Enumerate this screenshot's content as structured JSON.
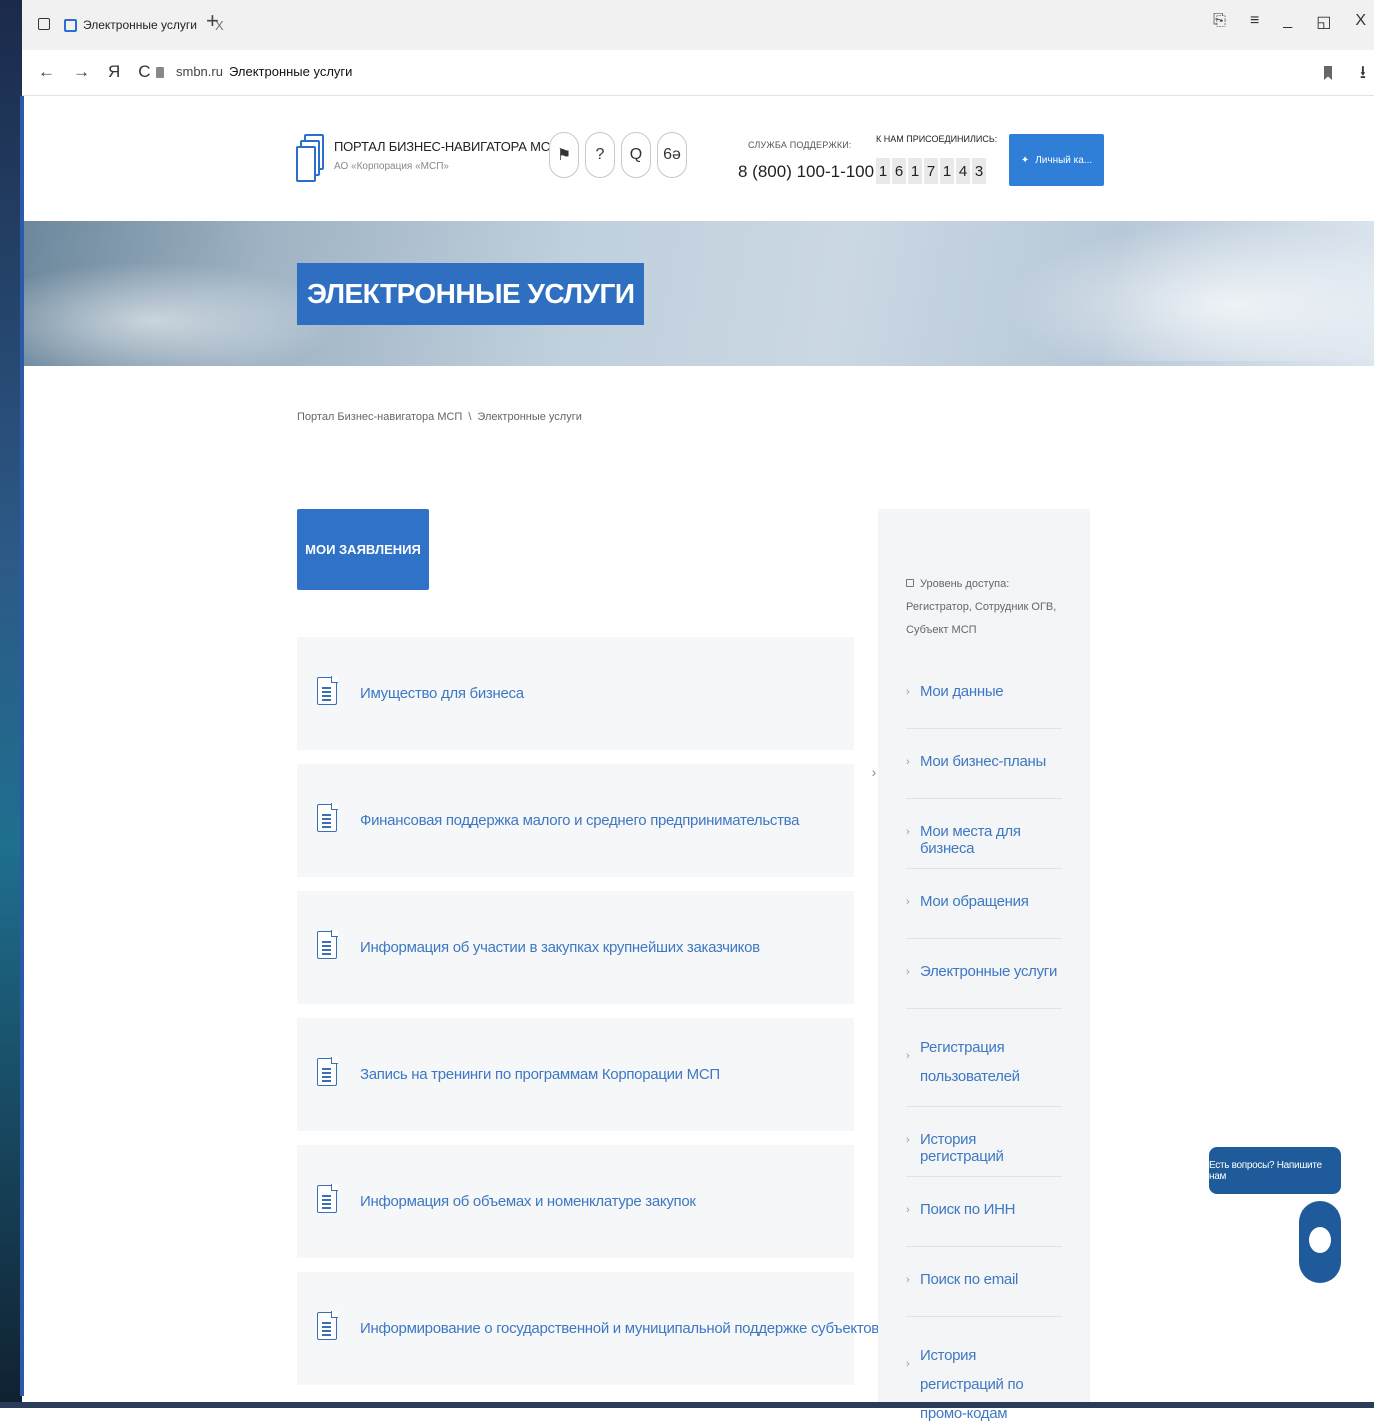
{
  "browser": {
    "tab_title": "Электронные услуги",
    "tab_close": "X",
    "new_tab": "+",
    "url_domain": "smbn.ru",
    "url_title": "Электронные услуги",
    "nav": {
      "back": "←",
      "forward": "→",
      "home": "Я",
      "reload": "C"
    },
    "window_controls": [
      "⎘",
      "≡",
      "_",
      "◱",
      "X"
    ],
    "download": "⭳"
  },
  "header": {
    "logo_title": "ПОРТАЛ БИЗНЕС-НАВИГАТОРА МСП",
    "logo_subtitle": "АО «Корпорация «МСП»",
    "icons": [
      {
        "name": "language-flag-icon",
        "glyph": "⚑"
      },
      {
        "name": "help-icon",
        "glyph": "?"
      },
      {
        "name": "search-icon",
        "glyph": "Q"
      },
      {
        "name": "accessibility-glasses-icon",
        "glyph": "6ə"
      }
    ],
    "support_label": "СЛУЖБА ПОДДЕРЖКИ:",
    "support_phone": "8 (800) 100-1-100",
    "joined_label": "К НАМ ПРИСОЕДИНИЛИСЬ:",
    "joined_digits": [
      "1",
      "6",
      "1",
      "7",
      "1",
      "4",
      "3"
    ],
    "account_button": "Личный ка..."
  },
  "hero": {
    "title": "ЭЛЕКТРОННЫЕ УСЛУГИ"
  },
  "breadcrumb": {
    "home": "Портал Бизнес-навигатора МСП",
    "separator": "\\",
    "current": "Электронные услуги"
  },
  "my_applications_button": "МОИ ЗАЯВЛЕНИЯ",
  "services": [
    "Имущество для бизнеса",
    "Финансовая поддержка малого и среднего предпринимательства",
    "Информация об участии в закупках крупнейших заказчиков",
    "Запись на тренинги по программам Корпорации МСП",
    "Информация об объемах и номенклатуре закупок",
    "Информирование о государственной и муниципальной поддержке субъектов МСП"
  ],
  "sidebar": {
    "access_level": "Уровень доступа: Регистратор, Сотрудник ОГВ, Субъект МСП",
    "items": [
      "Мои данные",
      "Мои бизнес-планы",
      "Мои места для бизнеса",
      "Мои обращения",
      "Электронные услуги",
      "Регистрация пользователей",
      "История регистраций",
      "Поиск по ИНН",
      "Поиск по email",
      "История регистраций по промо-кодам"
    ],
    "collapse_arrow": "›"
  },
  "chat": {
    "prompt": "Есть вопросы? Напишите нам"
  },
  "colors": {
    "accent": "#2f72c8",
    "link": "#3e78c3",
    "chat": "#1f5b9a"
  }
}
